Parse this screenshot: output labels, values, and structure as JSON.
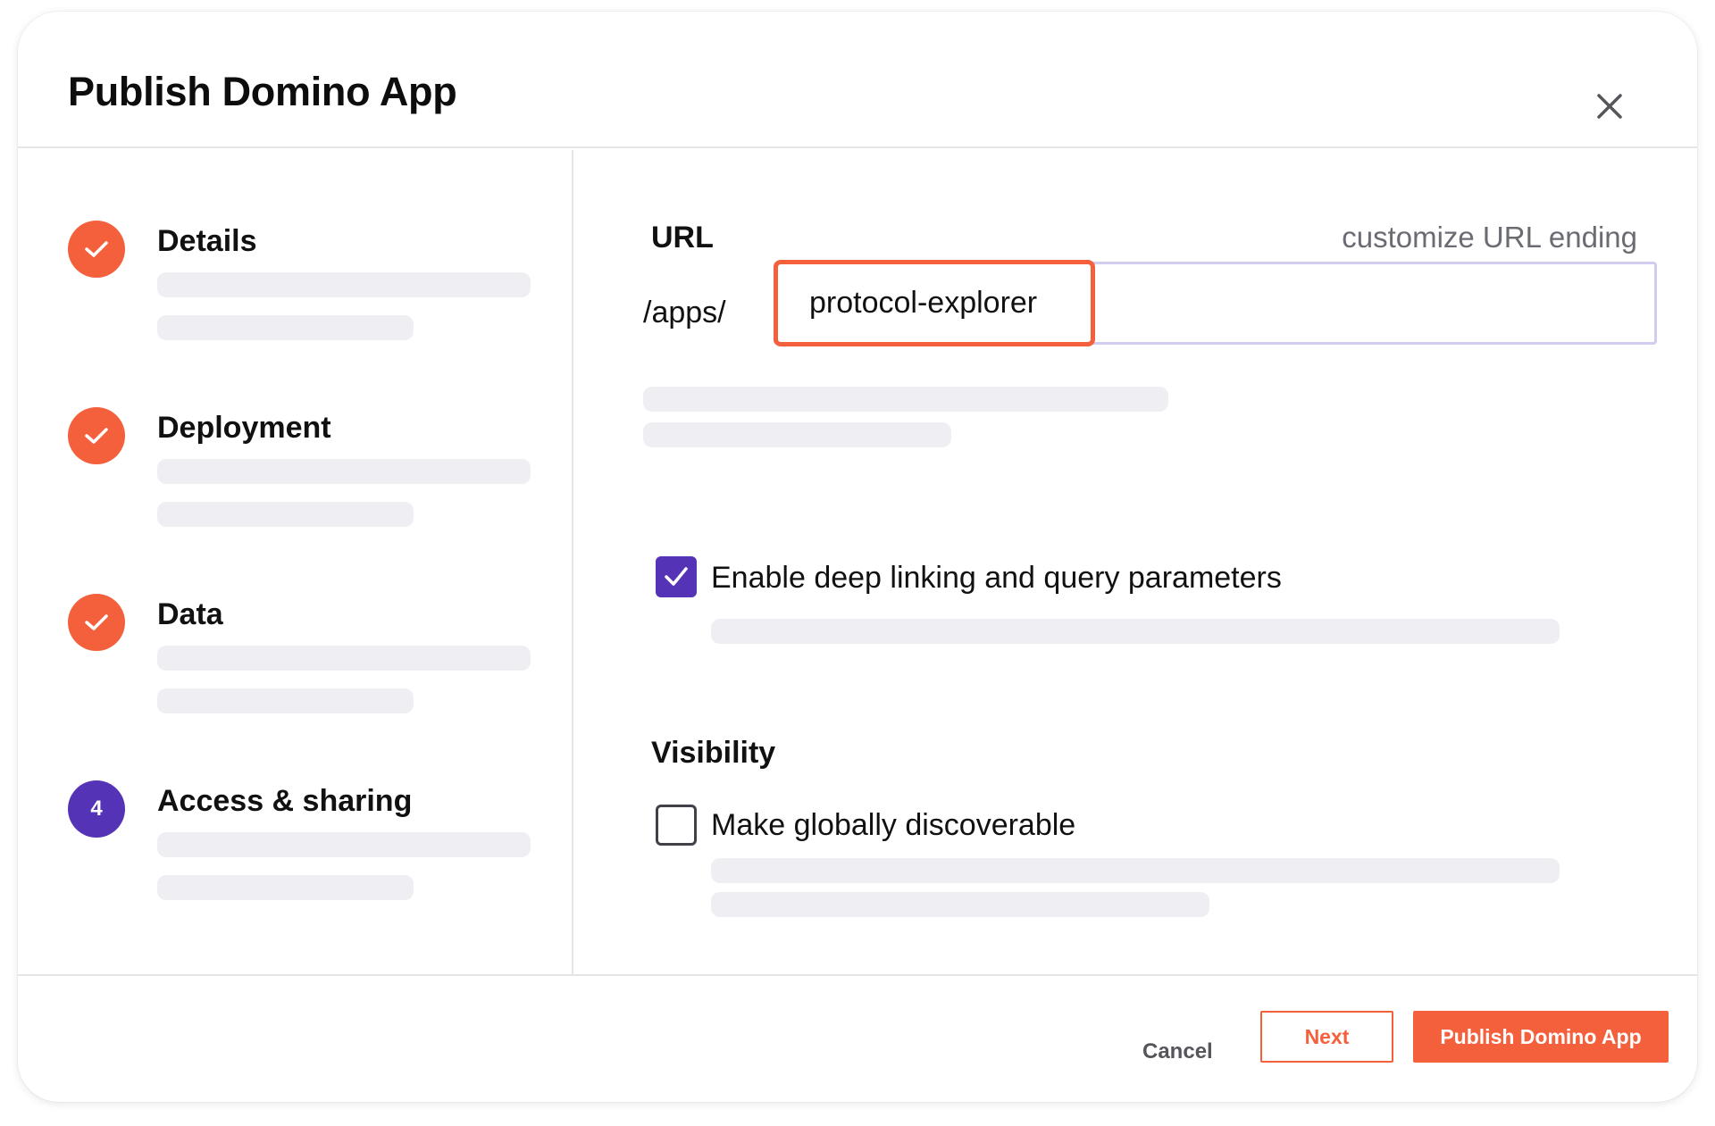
{
  "dialog": {
    "title": "Publish Domino App",
    "close_icon": "close-icon"
  },
  "colors": {
    "accent": "#f5603c",
    "active_step": "#5433b7",
    "checkbox": "#5433b7",
    "input_border": "#d1cdef",
    "skeleton": "#efeff3"
  },
  "steps": [
    {
      "title": "Details",
      "state": "complete",
      "icon": "check-icon"
    },
    {
      "title": "Deployment",
      "state": "complete",
      "icon": "check-icon"
    },
    {
      "title": "Data",
      "state": "complete",
      "icon": "check-icon"
    },
    {
      "title": "Access & sharing",
      "state": "active",
      "number": "4"
    }
  ],
  "url_section": {
    "label": "URL",
    "hint": "customize URL ending",
    "prefix": "/apps/",
    "value": "protocol-explorer"
  },
  "deep_linking": {
    "label": "Enable deep linking and query parameters",
    "checked": true
  },
  "visibility": {
    "label": "Visibility",
    "option_label": "Make globally discoverable",
    "checked": false
  },
  "footer": {
    "cancel_label": "Cancel",
    "next_label": "Next",
    "publish_label": "Publish Domino App"
  }
}
